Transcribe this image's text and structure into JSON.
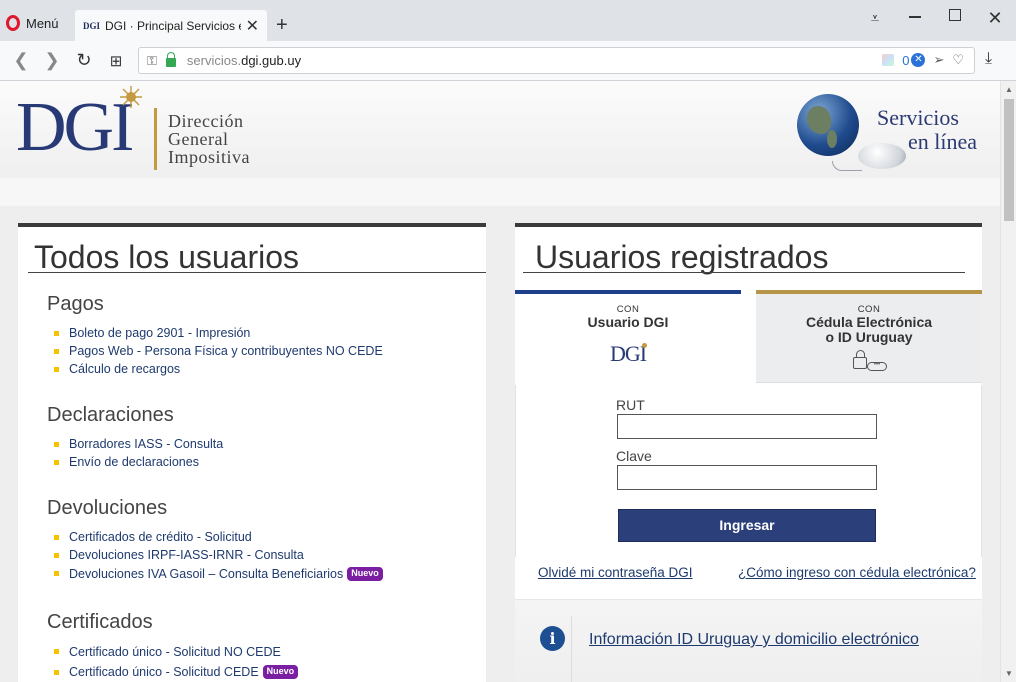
{
  "browser": {
    "menu_label": "Menú",
    "tab": {
      "favicon_text": "DGI",
      "title": "DGI · Principal Servicios en",
      "close_glyph": "✕"
    },
    "new_tab_glyph": "+",
    "window_controls": {
      "menu_glyph": "⩡",
      "close_glyph": "✕"
    },
    "nav": {
      "back_glyph": "❮",
      "forward_glyph": "❯",
      "reload_glyph": "↻",
      "grid_glyph": "⊞"
    },
    "url": {
      "prefix": "servicios.",
      "domain": "dgi.gub.uy"
    },
    "url_icons": {
      "key_glyph": "⚿",
      "count": "0",
      "shield_glyph": "✕",
      "send_glyph": "➢",
      "heart_glyph": "♡"
    },
    "download_glyph": "⤓"
  },
  "header": {
    "logo": {
      "letters": "DGI",
      "words": [
        "Dirección",
        "General",
        "Impositiva"
      ]
    },
    "services": {
      "line1": "Servicios",
      "line2": "en línea"
    }
  },
  "left_panel": {
    "title": "Todos los usuarios",
    "sections": [
      {
        "heading": "Pagos",
        "items": [
          {
            "label": "Boleto de pago 2901 - Impresión"
          },
          {
            "label": "Pagos Web - Persona Física y contribuyentes NO CEDE"
          },
          {
            "label": "Cálculo de recargos"
          }
        ]
      },
      {
        "heading": "Declaraciones",
        "items": [
          {
            "label": "Borradores IASS - Consulta"
          },
          {
            "label": "Envío de declaraciones"
          }
        ]
      },
      {
        "heading": "Devoluciones",
        "items": [
          {
            "label": "Certificados de crédito - Solicitud"
          },
          {
            "label": "Devoluciones IRPF-IASS-IRNR - Consulta"
          },
          {
            "label": "Devoluciones IVA Gasoil – Consulta Beneficiarios",
            "badge": "Nuevo"
          }
        ]
      },
      {
        "heading": "Certificados",
        "items": [
          {
            "label": "Certificado único - Solicitud NO CEDE"
          },
          {
            "label": "Certificado único - Solicitud CEDE",
            "badge": "Nuevo"
          }
        ]
      }
    ]
  },
  "right_panel": {
    "title": "Usuarios registrados",
    "tabs": [
      {
        "small": "CON",
        "big": "Usuario DGI",
        "logo": "DGI"
      },
      {
        "small": "CON",
        "big_line1": "Cédula Electrónica",
        "big_line2": "o ID Uruguay",
        "card_glyph": "•••"
      }
    ],
    "form": {
      "rut_label": "RUT",
      "rut_value": "",
      "clave_label": "Clave",
      "clave_value": "",
      "submit_label": "Ingresar"
    },
    "links": {
      "forgot": "Olvidé mi contraseña DGI",
      "how_cedula": "¿Cómo ingreso con cédula electrónica?"
    },
    "info": {
      "icon_glyph": "i",
      "link": "Información ID Uruguay y domicilio electrónico"
    }
  },
  "colors": {
    "brand_blue": "#283a76",
    "gold": "#c39a40",
    "link": "#1e3a6e",
    "bullet": "#f3c300",
    "badge": "#7b1fa2",
    "button": "#2b3f7a"
  }
}
